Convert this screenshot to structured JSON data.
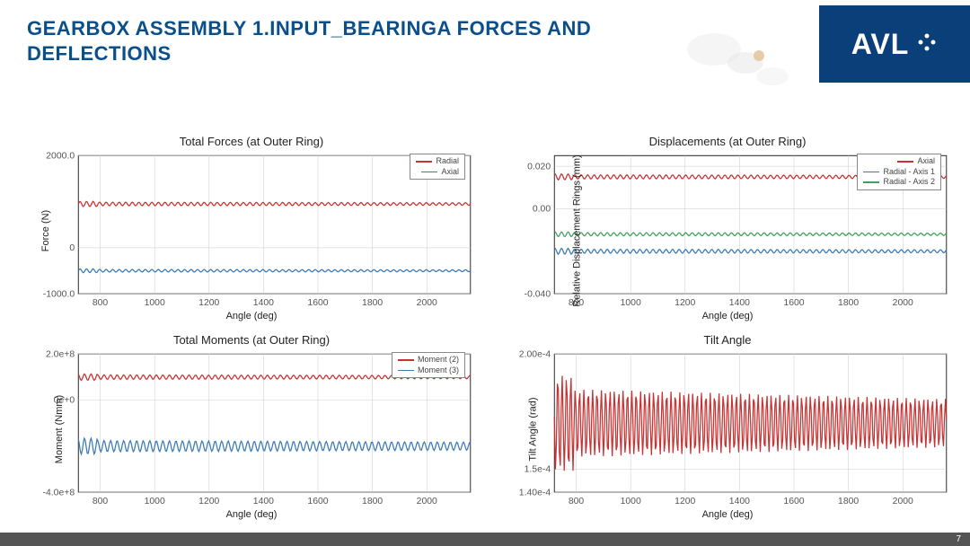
{
  "header": {
    "title": "GEARBOX ASSEMBLY 1.INPUT_BEARINGA FORCES AND DEFLECTIONS",
    "logo": "AVL"
  },
  "page_number": "7",
  "chart_data": [
    {
      "type": "line",
      "title": "Total Forces (at Outer Ring)",
      "xlabel": "Angle (deg)",
      "ylabel": "Force (N)",
      "xlim": [
        720,
        2160
      ],
      "xticks": [
        800,
        1000,
        1200,
        1400,
        1600,
        1800,
        2000
      ],
      "ylim": [
        -1000,
        2000
      ],
      "yticks": [
        -1000,
        0,
        2000
      ],
      "ytick_labels": [
        "-1000.0",
        "0",
        "2000.0"
      ],
      "series": [
        {
          "name": "Radial",
          "color": "#c83232",
          "mean": 950,
          "amplitude": 40,
          "freq": 60
        },
        {
          "name": "Axial",
          "color": "#3a7ab5",
          "mean": -500,
          "amplitude": 30,
          "freq": 60
        }
      ]
    },
    {
      "type": "line",
      "title": "Displacements (at Outer Ring)",
      "xlabel": "Angle (deg)",
      "ylabel": "Relative Displacement Rings (mm)",
      "xlim": [
        720,
        2160
      ],
      "xticks": [
        800,
        1000,
        1200,
        1400,
        1600,
        1800,
        2000
      ],
      "ylim": [
        -0.04,
        0.025
      ],
      "yticks": [
        -0.04,
        0.0,
        0.02
      ],
      "ytick_labels": [
        "-0.040",
        "0.00",
        "0.020"
      ],
      "series": [
        {
          "name": "Axial",
          "color": "#c83232",
          "mean": 0.015,
          "amplitude": 0.001,
          "freq": 60
        },
        {
          "name": "Radial - Axis 1",
          "color": "#3a7ab5",
          "mean": -0.02,
          "amplitude": 0.001,
          "freq": 60
        },
        {
          "name": "Radial - Axis 2",
          "color": "#3fa060",
          "mean": -0.012,
          "amplitude": 0.0008,
          "freq": 60
        }
      ]
    },
    {
      "type": "line",
      "title": "Total Moments (at Outer Ring)",
      "xlabel": "Angle (deg)",
      "ylabel": "Moment (Nmm)",
      "xlim": [
        720,
        2160
      ],
      "xticks": [
        800,
        1000,
        1200,
        1400,
        1600,
        1800,
        2000
      ],
      "ylim": [
        -400000000.0,
        200000000.0
      ],
      "yticks": [
        -400000000.0,
        0,
        200000000.0
      ],
      "ytick_labels": [
        "-4.0e+8",
        "0e+0",
        "2.0e+8"
      ],
      "series": [
        {
          "name": "Moment (2)",
          "color": "#c83232",
          "mean": 100000000.0,
          "amplitude": 10000000.0,
          "freq": 60
        },
        {
          "name": "Moment (3)",
          "color": "#3a7ab5",
          "mean": -200000000.0,
          "amplitude": 25000000.0,
          "freq": 60
        }
      ]
    },
    {
      "type": "line",
      "title": "Tilt Angle",
      "xlabel": "Angle (deg)",
      "ylabel": "Tilt Angle (rad)",
      "xlim": [
        720,
        2160
      ],
      "xticks": [
        800,
        1000,
        1200,
        1400,
        1600,
        1800,
        2000
      ],
      "ylim": [
        0.00014,
        0.0002
      ],
      "yticks": [
        0.00014,
        0.00015,
        0.0002
      ],
      "ytick_labels": [
        "1.40e-4",
        "1.5e-4",
        "2.00e-4"
      ],
      "series": [
        {
          "name": "",
          "color": "#c83232",
          "mean": 0.00017,
          "amplitude": 1.5e-05,
          "freq": 90
        }
      ]
    }
  ]
}
